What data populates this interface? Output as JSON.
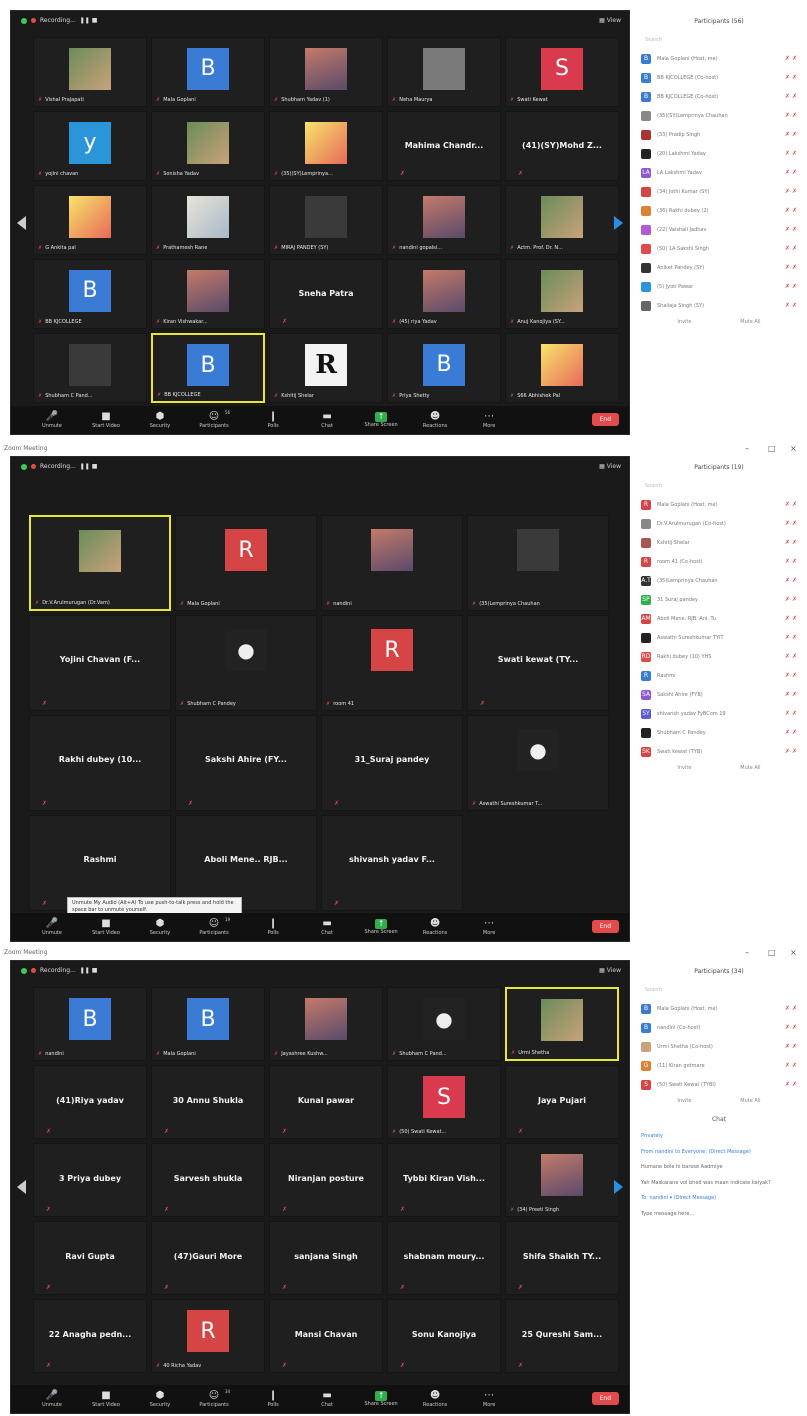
{
  "screens": [
    {
      "window_title": "",
      "recording": "Recording...",
      "view": "View",
      "participants_title": "Participants (56)",
      "tiles": [
        {
          "label": "Vishal Prajapati",
          "type": "photo"
        },
        {
          "label": "Mala Goplani",
          "type": "b",
          "letter": "B"
        },
        {
          "label": "Shubham Yadav (1)",
          "type": "photo2"
        },
        {
          "label": "Neha Maurya",
          "type": "grey"
        },
        {
          "label": "Swati Kewat",
          "type": "s",
          "letter": "S"
        },
        {
          "label": "yojini chavan",
          "type": "y",
          "letter": "y"
        },
        {
          "label": "Sonisha Yadav",
          "type": "photo"
        },
        {
          "label": "(35)(SY)Lemprinya...",
          "type": "cartoon"
        },
        {
          "label": "",
          "type": "name",
          "center": "Mahima Chandr..."
        },
        {
          "label": "",
          "type": "name",
          "center": "(41)(SY)Mohd Z..."
        },
        {
          "label": "G Ankita pal",
          "type": "cartoon"
        },
        {
          "label": "Prathamesh Rane",
          "type": "photo3"
        },
        {
          "label": "MIRAJ PANDEY (SY)",
          "type": "dark"
        },
        {
          "label": "nandini gopalsi...",
          "type": "photo2"
        },
        {
          "label": "Actm. Prof. Dr. N...",
          "type": "photo"
        },
        {
          "label": "BB KJCOLLEGE",
          "type": "b",
          "letter": "B"
        },
        {
          "label": "Kiran Vishwakar...",
          "type": "photo2"
        },
        {
          "label": "",
          "type": "name",
          "center": "Sneha Patra"
        },
        {
          "label": "(45) riya Yadav",
          "type": "photo2"
        },
        {
          "label": "Anuj Kanojiya (SY...",
          "type": "photo"
        },
        {
          "label": "Shubham C Pand...",
          "type": "dark"
        },
        {
          "label": "BB KJCOLLEGE",
          "type": "b",
          "letter": "B",
          "hl": true
        },
        {
          "label": "Kshitij Shelar",
          "type": "rr",
          "letter": "R"
        },
        {
          "label": "Priya Shetty",
          "type": "b",
          "letter": "B"
        },
        {
          "label": "S66 Abhishek Pal",
          "type": "cartoon"
        }
      ],
      "participants": [
        {
          "name": "Mala Goplani (Host, me)",
          "color": "#3a7bd5",
          "ch": "B"
        },
        {
          "name": "BB KJCOLLEGE (Co-host)",
          "color": "#3a7bd5",
          "ch": "B"
        },
        {
          "name": "BB KJCOLLEGE (Co-host)",
          "color": "#3a7bd5",
          "ch": "B"
        },
        {
          "name": "(35)(SY)Lemprinya Chauhan",
          "color": "#888",
          "ch": ""
        },
        {
          "name": "(33) Pradip Singh",
          "color": "#a33",
          "ch": ""
        },
        {
          "name": "(20) Lakshmi Yadav",
          "color": "#222",
          "ch": ""
        },
        {
          "name": "LA Lakshmi Yadav",
          "color": "#8a5ad6",
          "ch": "LA"
        },
        {
          "name": "(34) Jothi Kumar (SY)",
          "color": "#d64545",
          "ch": ""
        },
        {
          "name": "(36) Rakhi dubey (2)",
          "color": "#e08030",
          "ch": ""
        },
        {
          "name": "(22) Vaishali Jadhav",
          "color": "#b05ad6",
          "ch": ""
        },
        {
          "name": "(50) 1A Sakshi Singh",
          "color": "#e24b4b",
          "ch": ""
        },
        {
          "name": "Aniket Pandey (SY)",
          "color": "#333",
          "ch": ""
        },
        {
          "name": "(5) Jyoti Pawar",
          "color": "#2b95d9",
          "ch": ""
        },
        {
          "name": "Shailaja Singh (SY)",
          "color": "#666",
          "ch": ""
        }
      ],
      "invite": "Invite",
      "mute_all": "Mute All"
    },
    {
      "window_title": "Zoom Meeting",
      "recording": "Recording...",
      "view": "View",
      "participants_title": "Participants (19)",
      "tiles": [
        {
          "label": "Dr.V.Arulmurugan (Dr.Vam)",
          "type": "photo",
          "hl": true
        },
        {
          "label": "Mala Goplani",
          "type": "r",
          "letter": "R"
        },
        {
          "label": "nandini",
          "type": "photo2"
        },
        {
          "label": "(35)Lemprinya Chauhan",
          "type": "dark"
        },
        {
          "label": "",
          "type": "name",
          "center": "Yojini Chavan (F..."
        },
        {
          "label": "Shubham C Pandey",
          "type": "user",
          "letter": "●"
        },
        {
          "label": "room 41",
          "type": "r",
          "letter": "R"
        },
        {
          "label": "",
          "type": "name",
          "center": "Swati kewat (TY..."
        },
        {
          "label": "",
          "type": "name",
          "center": "Rakhi dubey (10..."
        },
        {
          "label": "",
          "type": "name",
          "center": "Sakshi Ahire (FY..."
        },
        {
          "label": "",
          "type": "name",
          "center": "31_Suraj pandey"
        },
        {
          "label": "Aswathi Sureshkumar T...",
          "type": "user",
          "letter": "●"
        },
        {
          "label": "",
          "type": "name",
          "center": "Rashmi"
        },
        {
          "label": "",
          "type": "name",
          "center": "Aboli Mene.. RJB..."
        },
        {
          "label": "",
          "type": "name",
          "center": "shivansh yadav F..."
        }
      ],
      "participants": [
        {
          "name": "Mala Goplani (Host, me)",
          "color": "#d64545",
          "ch": "R"
        },
        {
          "name": "Dr.V.Arulmurugan (Co-host)",
          "color": "#888",
          "ch": ""
        },
        {
          "name": "Kshitij Shelar",
          "color": "#a55",
          "ch": ""
        },
        {
          "name": "room 41 (Co-host)",
          "color": "#d64545",
          "ch": "R"
        },
        {
          "name": "(35)Lemprinya Chauhan",
          "color": "#333",
          "ch": "A.T"
        },
        {
          "name": "31 Suraj pandey",
          "color": "#2fae4e",
          "ch": "SP"
        },
        {
          "name": "Aboli Mene. RJB. Ani. Tu",
          "color": "#d64545",
          "ch": "AM"
        },
        {
          "name": "Aswathi Sureshkumar TYIT",
          "color": "#222",
          "ch": ""
        },
        {
          "name": "Rakhi dubey (10) YHS",
          "color": "#e24b4b",
          "ch": "RD"
        },
        {
          "name": "Rashmi",
          "color": "#3a7bd5",
          "ch": "R"
        },
        {
          "name": "Sakshi Ahire (FYB)",
          "color": "#8a5ad6",
          "ch": "SA"
        },
        {
          "name": "shivansh yadav FyBCom 19",
          "color": "#5a5ad6",
          "ch": "SY"
        },
        {
          "name": "Shubham C Pandey",
          "color": "#222",
          "ch": ""
        },
        {
          "name": "Swati kewat (TYB)",
          "color": "#d64545",
          "ch": "SK"
        }
      ],
      "invite": "Invite",
      "mute_all": "Mute All",
      "tooltip": "Unmute My Audio (Alt+A) To use push-to-talk press and hold the space bar to unmute yourself."
    },
    {
      "window_title": "Zoom Meeting",
      "recording": "Recording...",
      "view": "View",
      "participants_title": "Participants (34)",
      "tiles": [
        {
          "label": "nandini",
          "type": "b",
          "letter": "B"
        },
        {
          "label": "Mala Goplani",
          "type": "b",
          "letter": "B"
        },
        {
          "label": "Jayashree Kushw...",
          "type": "photo2"
        },
        {
          "label": "Shubham C Pand...",
          "type": "user",
          "letter": "●"
        },
        {
          "label": "Urmi Shetha",
          "type": "photo",
          "hl": true
        },
        {
          "label": "",
          "type": "name",
          "center": "(41)Riya yadav"
        },
        {
          "label": "",
          "type": "name",
          "center": "30 Annu Shukla"
        },
        {
          "label": "",
          "type": "name",
          "center": "Kunal pawar"
        },
        {
          "label": "(50) Swati Kewat...",
          "type": "s",
          "letter": "S"
        },
        {
          "label": "",
          "type": "name",
          "center": "Jaya Pujari"
        },
        {
          "label": "",
          "type": "name",
          "center": "3 Priya dubey"
        },
        {
          "label": "",
          "type": "name",
          "center": "Sarvesh shukla"
        },
        {
          "label": "",
          "type": "name",
          "center": "Niranjan posture"
        },
        {
          "label": "",
          "type": "name",
          "center": "Tybbi Kiran Vish..."
        },
        {
          "label": "(34) Preeti Singh",
          "type": "photo2"
        },
        {
          "label": "",
          "type": "name",
          "center": "Ravi Gupta"
        },
        {
          "label": "",
          "type": "name",
          "center": "(47)Gauri More"
        },
        {
          "label": "",
          "type": "name",
          "center": "sanjana Singh"
        },
        {
          "label": "",
          "type": "name",
          "center": "shabnam moury..."
        },
        {
          "label": "",
          "type": "name",
          "center": "Shifa Shaikh TY..."
        },
        {
          "label": "",
          "type": "name",
          "center": "22 Anagha pedn..."
        },
        {
          "label": "40 Richa Yadav",
          "type": "r",
          "letter": "R"
        },
        {
          "label": "",
          "type": "name",
          "center": "Mansi Chavan"
        },
        {
          "label": "",
          "type": "name",
          "center": "Sonu Kanojiya"
        },
        {
          "label": "",
          "type": "name",
          "center": "25 Qureshi Sam..."
        }
      ],
      "participants": [
        {
          "name": "Mala Goplani (Host, me)",
          "color": "#3a7bd5",
          "ch": "B"
        },
        {
          "name": "nandini (Co-host)",
          "color": "#3a7bd5",
          "ch": "B"
        },
        {
          "name": "Urmi Shetha (Co-host)",
          "color": "#c9a27a",
          "ch": ""
        },
        {
          "name": "(11) Kiran gotmare",
          "color": "#e08030",
          "ch": "G"
        },
        {
          "name": "(50) Swati Kewat (TYBI)",
          "color": "#d64545",
          "ch": "S"
        }
      ],
      "invite": "Invite",
      "mute_all": "Mute All",
      "chat_title": "Chat",
      "chat_lines": [
        "Privately",
        "From nandini to Everyone: (Direct Message)",
        "Humane bole hi barose Aadmiye",
        "Yah Maskarane vol bhed was maan indicate kaiyak?",
        "To: nandini ▾ (Direct Message)",
        "Type message here..."
      ]
    }
  ],
  "toolbar": {
    "unmute": "Unmute",
    "start_video": "Start Video",
    "security": "Security",
    "participants": "Participants",
    "polls": "Polls",
    "chat": "Chat",
    "share_screen": "Share Screen",
    "reactions": "Reactions",
    "more": "More",
    "end": "End"
  },
  "participant_counts": [
    "56",
    "19",
    "34"
  ]
}
